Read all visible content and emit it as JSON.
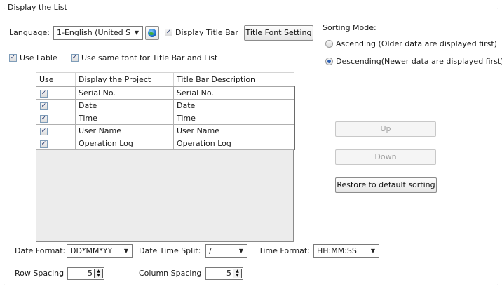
{
  "group_title": "Display the List",
  "language": {
    "label": "Language:",
    "value": "1-English (United S"
  },
  "display_title_bar": {
    "label": "Display Title Bar",
    "checked": true
  },
  "title_font_button": "Title Font Setting",
  "use_lable": {
    "label": "Use Lable",
    "checked": true
  },
  "same_font": {
    "label": "Use same font for Title Bar and List",
    "checked": true
  },
  "sorting": {
    "title": "Sorting Mode:",
    "ascending": "Ascending (Older data are displayed first)",
    "descending": "Descending(Newer data are displayed first)",
    "selected": "descending"
  },
  "table": {
    "headers": [
      "Use",
      "Display the Project",
      "Title Bar Description"
    ],
    "rows": [
      {
        "checked": true,
        "project": "Serial No.",
        "desc": "Serial No."
      },
      {
        "checked": true,
        "project": "Date",
        "desc": "Date"
      },
      {
        "checked": true,
        "project": "Time",
        "desc": "Time"
      },
      {
        "checked": true,
        "project": "User Name",
        "desc": "User Name"
      },
      {
        "checked": true,
        "project": "Operation Log",
        "desc": "Operation Log"
      }
    ]
  },
  "buttons": {
    "up": "Up",
    "down": "Down",
    "restore": "Restore to default sorting"
  },
  "date_format": {
    "label": "Date Format:",
    "value": "DD*MM*YY"
  },
  "date_time_split": {
    "label": "Date Time Split:",
    "value": "/"
  },
  "time_format": {
    "label": "Time Format:",
    "value": "HH:MM:SS"
  },
  "row_spacing": {
    "label": "Row Spacing",
    "value": "5"
  },
  "column_spacing": {
    "label": "Column Spacing",
    "value": "5"
  }
}
